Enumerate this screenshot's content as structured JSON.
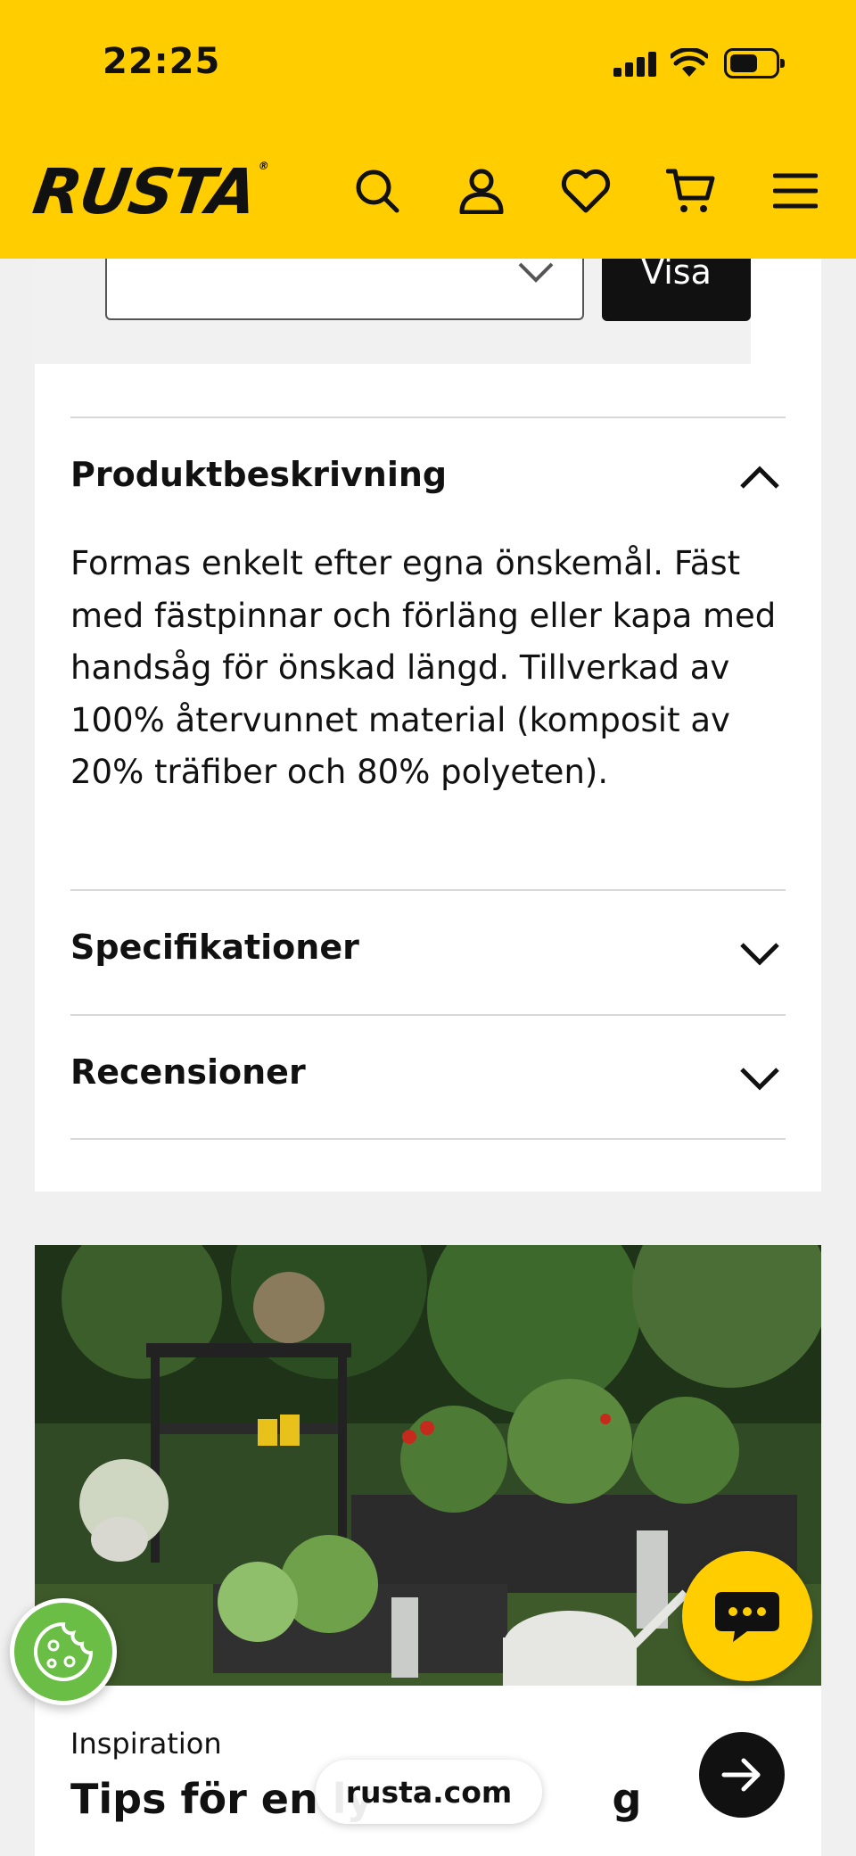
{
  "status_bar": {
    "time": "22:25"
  },
  "header": {
    "logo": "RUSTA",
    "icons": [
      "search-icon",
      "account-icon",
      "heart-icon",
      "cart-icon",
      "menu-icon"
    ]
  },
  "variant_selector": {
    "value": "",
    "button_label": "Visa"
  },
  "accordion": [
    {
      "title": "Produktbeskrivning",
      "expanded": true,
      "body": "Formas enkelt efter egna önskemål. Fäst med fästpinnar och förläng eller kapa med handsåg för önskad längd. Tillverkad av 100% återvunnet material (komposit av 20% träfiber och 80% polyeten)."
    },
    {
      "title": "Specifikationer",
      "expanded": false
    },
    {
      "title": "Recensioner",
      "expanded": false
    }
  ],
  "inspiration": {
    "kicker": "Inspiration",
    "title": "Tips för en ly",
    "title_tail": "g"
  },
  "browser": {
    "url": "rusta.com"
  },
  "colors": {
    "brand_yellow": "#ffcd00",
    "cookie_green": "#6abd45",
    "dark": "#111111"
  }
}
